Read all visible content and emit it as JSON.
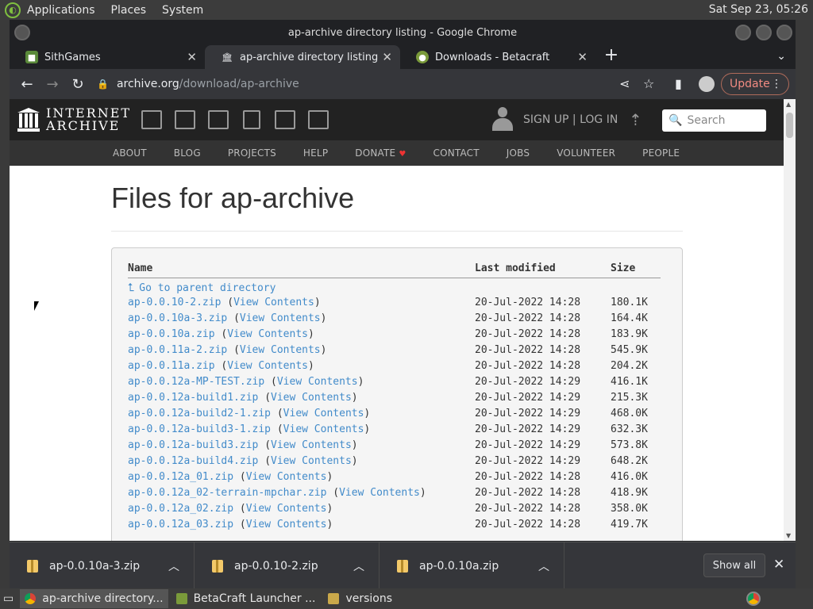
{
  "system": {
    "menus": [
      "Applications",
      "Places",
      "System"
    ],
    "clock": "Sat Sep 23, 05:26"
  },
  "window": {
    "title": "ap-archive directory listing - Google Chrome"
  },
  "tabs": [
    {
      "label": "SithGames",
      "icon": "minecraft-block-icon"
    },
    {
      "label": "ap-archive directory listing",
      "icon": "archive-temple-icon"
    },
    {
      "label": "Downloads - Betacraft",
      "icon": "betacraft-icon"
    }
  ],
  "omnibox": {
    "host": "archive.org",
    "path": "/download/ap-archive"
  },
  "toolbar": {
    "update_label": "Update"
  },
  "ia": {
    "logo_line1": "INTERNET",
    "logo_line2": "ARCHIVE",
    "signup": "SIGN UP | LOG IN",
    "search_placeholder": "Search",
    "nav": [
      "ABOUT",
      "BLOG",
      "PROJECTS",
      "HELP",
      "DONATE",
      "CONTACT",
      "JOBS",
      "VOLUNTEER",
      "PEOPLE"
    ]
  },
  "listing": {
    "title": "Files for ap-archive",
    "headers": {
      "name": "Name",
      "modified": "Last modified",
      "size": "Size"
    },
    "parent_label": "Go to parent directory",
    "view_label": "View Contents",
    "files": [
      {
        "name": "ap-0.0.10-2.zip",
        "modified": "20-Jul-2022 14:28",
        "size": "180.1K"
      },
      {
        "name": "ap-0.0.10a-3.zip",
        "modified": "20-Jul-2022 14:28",
        "size": "164.4K"
      },
      {
        "name": "ap-0.0.10a.zip",
        "modified": "20-Jul-2022 14:28",
        "size": "183.9K"
      },
      {
        "name": "ap-0.0.11a-2.zip",
        "modified": "20-Jul-2022 14:28",
        "size": "545.9K"
      },
      {
        "name": "ap-0.0.11a.zip",
        "modified": "20-Jul-2022 14:28",
        "size": "204.2K"
      },
      {
        "name": "ap-0.0.12a-MP-TEST.zip",
        "modified": "20-Jul-2022 14:29",
        "size": "416.1K"
      },
      {
        "name": "ap-0.0.12a-build1.zip",
        "modified": "20-Jul-2022 14:29",
        "size": "215.3K"
      },
      {
        "name": "ap-0.0.12a-build2-1.zip",
        "modified": "20-Jul-2022 14:29",
        "size": "468.0K"
      },
      {
        "name": "ap-0.0.12a-build3-1.zip",
        "modified": "20-Jul-2022 14:29",
        "size": "632.3K"
      },
      {
        "name": "ap-0.0.12a-build3.zip",
        "modified": "20-Jul-2022 14:29",
        "size": "573.8K"
      },
      {
        "name": "ap-0.0.12a-build4.zip",
        "modified": "20-Jul-2022 14:29",
        "size": "648.2K"
      },
      {
        "name": "ap-0.0.12a_01.zip",
        "modified": "20-Jul-2022 14:28",
        "size": "416.0K"
      },
      {
        "name": "ap-0.0.12a_02-terrain-mpchar.zip",
        "modified": "20-Jul-2022 14:28",
        "size": "418.9K"
      },
      {
        "name": "ap-0.0.12a_02.zip",
        "modified": "20-Jul-2022 14:28",
        "size": "358.0K"
      },
      {
        "name": "ap-0.0.12a_03.zip",
        "modified": "20-Jul-2022 14:28",
        "size": "419.7K"
      }
    ]
  },
  "downloads": {
    "items": [
      "ap-0.0.10a-3.zip",
      "ap-0.0.10-2.zip",
      "ap-0.0.10a.zip"
    ],
    "show_all": "Show all"
  },
  "taskbar": {
    "items": [
      "ap-archive directory...",
      "BetaCraft Launcher ...",
      "versions"
    ]
  }
}
